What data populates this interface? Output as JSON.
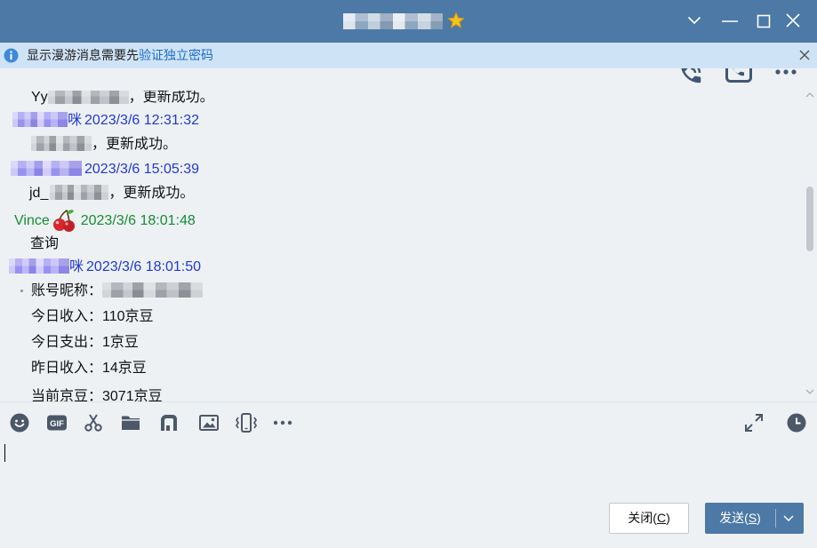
{
  "colors": {
    "titlebar": "#4c79a6",
    "window_bg": "#eef1f4",
    "notice_bg": "#cfe3f7",
    "link": "#1c6cc6",
    "sender_blue": "#2139d6",
    "sender_green": "#168c34",
    "icon": "#4b5868",
    "action_icon": "#3f5774",
    "send_button": "#4c79a6"
  },
  "title_bar": {
    "badge_icon": "star-badge-icon",
    "controls": [
      "chevron-down-icon",
      "minimize-icon",
      "maximize-icon",
      "close-icon"
    ]
  },
  "notice": {
    "icon": "info-icon",
    "text": "显示漫游消息需要先",
    "link": "验证独立密码",
    "close_icon": "close-icon"
  },
  "chat_actions": [
    "phone-call-icon",
    "screen-share-icon",
    "more-icon"
  ],
  "messages": [
    {
      "body_prefix": "Yy",
      "body_suffix": "，更新成功。"
    },
    {
      "sender_suffix": "咪",
      "time": "2023/3/6 12:31:32",
      "body_suffix": "，更新成功。"
    },
    {
      "time": "2023/3/6 15:05:39",
      "body_prefix": "jd_",
      "body_suffix": "，更新成功。"
    },
    {
      "sender": "Vince",
      "sender_icon": "cherry-icon",
      "time": "2023/3/6 18:01:48",
      "body": "查询"
    },
    {
      "sender_suffix": "咪",
      "time": "2023/3/6 18:01:50",
      "lines": [
        "账号昵称：",
        "今日收入：110京豆",
        "今日支出：1京豆",
        "昨日收入：14京豆",
        "当前京豆：3071京豆"
      ]
    }
  ],
  "toolbar": {
    "left": [
      "emoji-icon",
      "gif-icon",
      "scissors-icon",
      "folder-icon",
      "music-icon",
      "image-icon",
      "shake-icon",
      "more-icon"
    ],
    "gif_label": "GIF",
    "right": [
      "expand-icon",
      "history-icon"
    ]
  },
  "buttons": {
    "close": {
      "prefix": "关闭(",
      "hotkey": "C",
      "suffix": ")"
    },
    "send": {
      "prefix": "发送(",
      "hotkey": "S",
      "suffix": ")",
      "dropdown_icon": "chevron-down-icon"
    }
  }
}
